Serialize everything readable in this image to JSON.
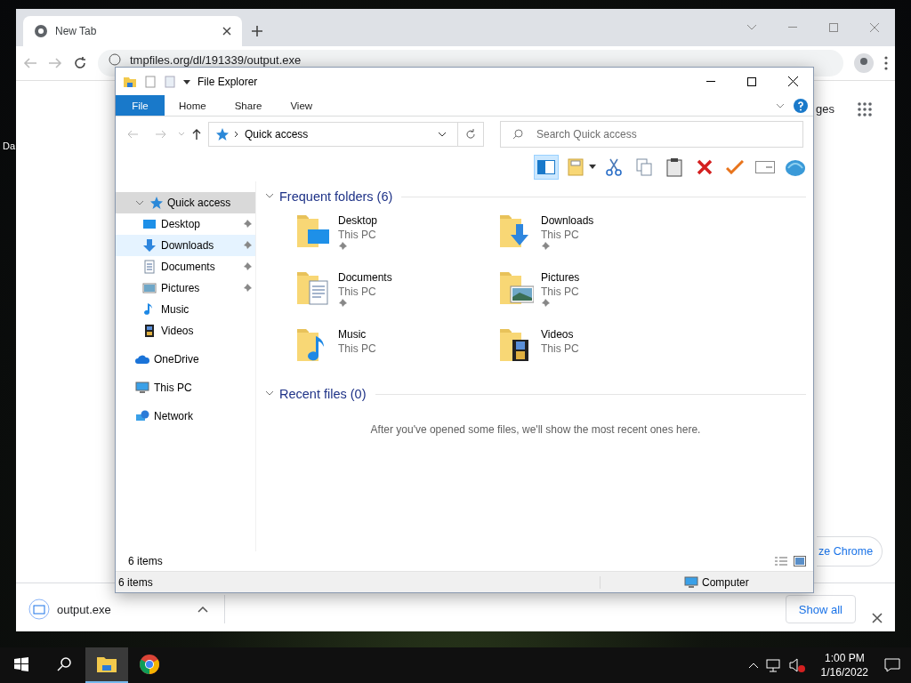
{
  "desktop": {
    "icon_label": "Da"
  },
  "browser": {
    "tab_title": "New Tab",
    "url": "tmpfiles.org/dl/191339/output.exe",
    "page_link": "ges",
    "customize_button": "ze Chrome",
    "download_file": "output.exe",
    "show_all": "Show all"
  },
  "explorer": {
    "title": "File Explorer",
    "ribbon_tabs": [
      {
        "label": "File",
        "selected": true
      },
      {
        "label": "Home",
        "selected": false
      },
      {
        "label": "Share",
        "selected": false
      },
      {
        "label": "View",
        "selected": false
      }
    ],
    "address": "Quick access",
    "search": {
      "placeholder": "Search Quick access"
    },
    "nav": [
      {
        "label": "Quick access",
        "kind": "quick",
        "selected": true,
        "hovered": false,
        "pinned": false,
        "children": [
          {
            "label": "Desktop",
            "kind": "desktop",
            "selected": false,
            "hovered": false,
            "pinned": true
          },
          {
            "label": "Downloads",
            "kind": "downloads",
            "selected": false,
            "hovered": true,
            "pinned": true
          },
          {
            "label": "Documents",
            "kind": "documents",
            "selected": false,
            "hovered": false,
            "pinned": true
          },
          {
            "label": "Pictures",
            "kind": "pictures",
            "selected": false,
            "hovered": false,
            "pinned": true
          },
          {
            "label": "Music",
            "kind": "music",
            "selected": false,
            "hovered": false,
            "pinned": false
          },
          {
            "label": "Videos",
            "kind": "videos",
            "selected": false,
            "hovered": false,
            "pinned": false
          }
        ]
      },
      {
        "label": "OneDrive",
        "kind": "onedrive",
        "selected": false,
        "hovered": false,
        "pinned": false
      },
      {
        "label": "This PC",
        "kind": "pc",
        "selected": false,
        "hovered": false,
        "pinned": false
      },
      {
        "label": "Network",
        "kind": "network",
        "selected": false,
        "hovered": false,
        "pinned": false
      }
    ],
    "sections": [
      {
        "title": "Frequent folders (6)",
        "expanded": true,
        "items": [
          {
            "name": "Desktop",
            "location": "This PC",
            "kind": "desktop",
            "pinned": true
          },
          {
            "name": "Downloads",
            "location": "This PC",
            "kind": "downloads",
            "pinned": true
          },
          {
            "name": "Documents",
            "location": "This PC",
            "kind": "documents",
            "pinned": true
          },
          {
            "name": "Pictures",
            "location": "This PC",
            "kind": "pictures",
            "pinned": true
          },
          {
            "name": "Music",
            "location": "This PC",
            "kind": "music",
            "pinned": false
          },
          {
            "name": "Videos",
            "location": "This PC",
            "kind": "videos",
            "pinned": false
          }
        ]
      },
      {
        "title": "Recent files (0)",
        "expanded": true,
        "empty_text": "After you've opened some files, we'll show the most recent ones here."
      }
    ],
    "item_count": "6 items",
    "status_left": "6 items",
    "status_right": "Computer"
  },
  "taskbar": {
    "apps": [
      {
        "kind": "explorer",
        "selected": true
      },
      {
        "kind": "chrome",
        "selected": false
      }
    ],
    "time": "1:00 PM",
    "date": "1/16/2022"
  }
}
